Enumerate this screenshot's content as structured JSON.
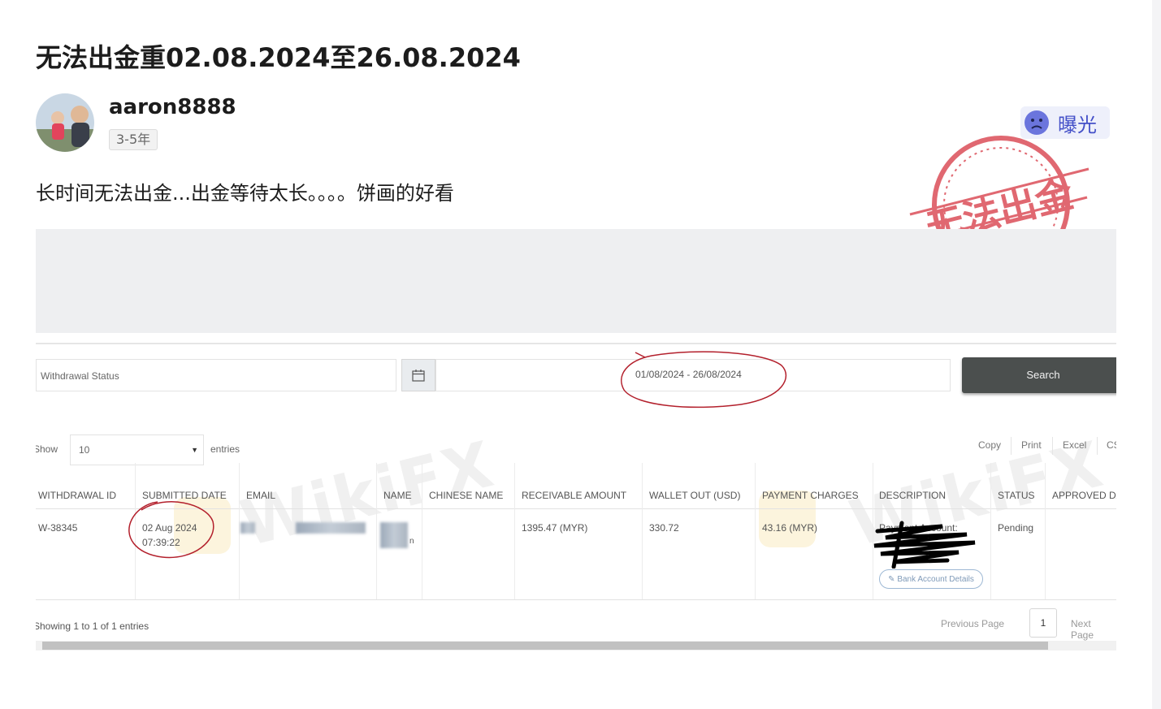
{
  "post": {
    "title": "无法出金重02.08.2024至26.08.2024",
    "author": "aaron8888",
    "tenure": "3-5年",
    "body": "长时间无法出金...出金等待太长。。。。饼画的好看",
    "badge_label": "曝光"
  },
  "screenshot": {
    "filter": {
      "status_placeholder": "Withdrawal Status",
      "date_range": "01/08/2024 - 26/08/2024",
      "search_label": "Search"
    },
    "controls": {
      "show_label": "Show",
      "page_length": "10",
      "entries_label": "entries",
      "exports": [
        "Copy",
        "Print",
        "Excel",
        "CSV"
      ]
    },
    "table": {
      "headers": [
        "WITHDRAWAL ID",
        "SUBMITTED DATE",
        "EMAIL",
        "NAME",
        "CHINESE NAME",
        "RECEIVABLE AMOUNT",
        "WALLET OUT (USD)",
        "PAYMENT CHARGES",
        "DESCRIPTION",
        "STATUS",
        "APPROVED DATE"
      ],
      "row": {
        "withdrawal_id": "W-38345",
        "submitted_date": "02 Aug 2024",
        "submitted_time": "07:39:22",
        "name_fragment": "n",
        "receivable_amount": "1395.47 (MYR)",
        "wallet_out": "330.72",
        "payment_charges": "43.16 (MYR)",
        "description": "Payment Account:",
        "bank_button": "Bank Account Details",
        "status": "Pending"
      }
    },
    "footer": {
      "showing": "Showing 1 to 1 of 1 entries",
      "previous": "Previous Page",
      "page": "1",
      "next": "Next Page"
    },
    "watermark": "WikiFX"
  },
  "stamp_text": "无法出金",
  "colors": {
    "stamp_red": "#d9434e",
    "badge_blue": "#4450c8",
    "search_button": "#4b4f4e",
    "annotation_red": "#b3202c"
  }
}
